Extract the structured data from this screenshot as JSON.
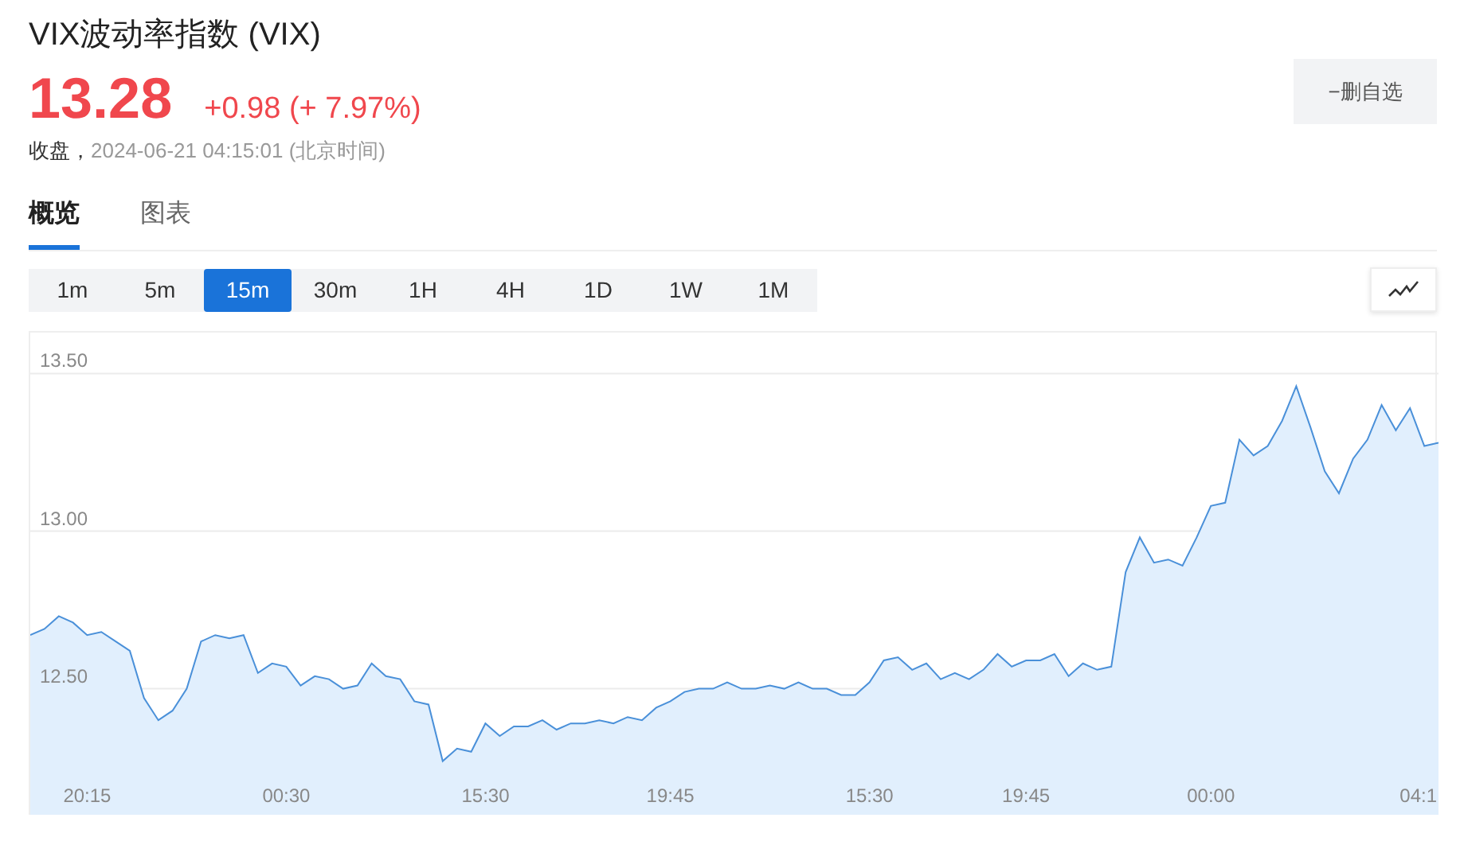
{
  "title": "VIX波动率指数 (VIX)",
  "quote": {
    "price": "13.28",
    "change": "+0.98 (+ 7.97%)",
    "status": "收盘，",
    "time": "2024-06-21 04:15:01 (北京时间)"
  },
  "watch_button": "−删自选",
  "tabs": [
    {
      "label": "概览",
      "selected": true
    },
    {
      "label": "图表",
      "selected": false
    }
  ],
  "periods": [
    {
      "label": "1m",
      "selected": false
    },
    {
      "label": "5m",
      "selected": false
    },
    {
      "label": "15m",
      "selected": true
    },
    {
      "label": "30m",
      "selected": false
    },
    {
      "label": "1H",
      "selected": false
    },
    {
      "label": "4H",
      "selected": false
    },
    {
      "label": "1D",
      "selected": false
    },
    {
      "label": "1W",
      "selected": false
    },
    {
      "label": "1M",
      "selected": false
    }
  ],
  "chart": {
    "chart_data": {
      "type": "area",
      "grid": true,
      "ylim": [
        12.1,
        13.63
      ],
      "yticks": [
        {
          "value": 12.5,
          "label": "12.50"
        },
        {
          "value": 13,
          "label": "13.00"
        },
        {
          "value": 13.5,
          "label": "13.50"
        }
      ],
      "categories": [
        null,
        null,
        null,
        null,
        "20:15",
        null,
        null,
        null,
        null,
        null,
        null,
        null,
        null,
        null,
        null,
        null,
        null,
        null,
        "00:30",
        null,
        null,
        null,
        null,
        null,
        null,
        null,
        null,
        null,
        null,
        null,
        null,
        null,
        "15:30",
        null,
        null,
        null,
        null,
        null,
        null,
        null,
        null,
        null,
        null,
        null,
        null,
        "19:45",
        null,
        null,
        null,
        null,
        null,
        null,
        null,
        null,
        null,
        null,
        null,
        null,
        null,
        "15:30",
        null,
        null,
        null,
        null,
        null,
        null,
        null,
        null,
        null,
        null,
        "19:45",
        null,
        null,
        null,
        null,
        null,
        null,
        null,
        null,
        null,
        null,
        null,
        null,
        "00:00",
        null,
        null,
        null,
        null,
        null,
        null,
        null,
        null,
        null,
        null,
        null,
        null,
        null,
        null,
        "04:1",
        null
      ],
      "series": [
        {
          "color": "#4a90d9",
          "values": [
            12.67,
            12.69,
            12.73,
            12.71,
            12.67,
            12.68,
            12.65,
            12.62,
            12.47,
            12.4,
            12.43,
            12.5,
            12.65,
            12.67,
            12.66,
            12.67,
            12.55,
            12.58,
            12.57,
            12.51,
            12.54,
            12.53,
            12.5,
            12.51,
            12.58,
            12.54,
            12.53,
            12.46,
            12.45,
            12.27,
            12.31,
            12.3,
            12.39,
            12.35,
            12.38,
            12.38,
            12.4,
            12.37,
            12.39,
            12.39,
            12.4,
            12.39,
            12.41,
            12.4,
            12.44,
            12.46,
            12.49,
            12.5,
            12.5,
            12.52,
            12.5,
            12.5,
            12.51,
            12.5,
            12.52,
            12.5,
            12.5,
            12.48,
            12.48,
            12.52,
            12.59,
            12.6,
            12.56,
            12.58,
            12.53,
            12.55,
            12.53,
            12.56,
            12.61,
            12.57,
            12.59,
            12.59,
            12.61,
            12.54,
            12.58,
            12.56,
            12.57,
            12.87,
            12.98,
            12.9,
            12.91,
            12.89,
            12.98,
            13.08,
            13.09,
            13.29,
            13.24,
            13.27,
            13.35,
            13.46,
            13.33,
            13.19,
            13.12,
            13.23,
            13.29,
            13.4,
            13.32,
            13.39,
            13.27,
            13.28
          ]
        }
      ]
    }
  }
}
